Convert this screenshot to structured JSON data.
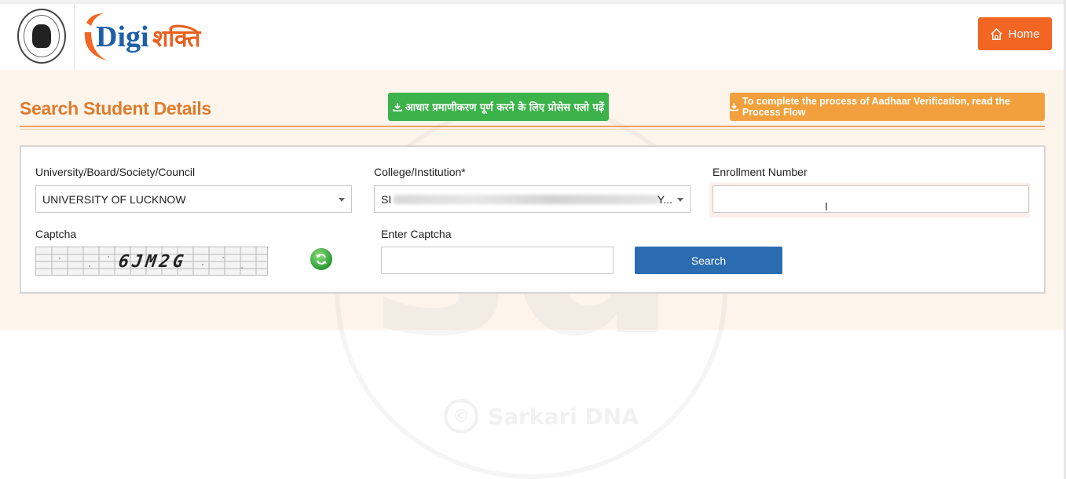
{
  "header": {
    "logo_text_latin": "Digi",
    "logo_text_devanagari": "शक्ति",
    "home_label": "Home"
  },
  "colors": {
    "primary_orange": "#f26522",
    "title_orange": "#e07b2c",
    "green_button": "#3bb34a",
    "orange_button": "#f2a03d",
    "search_blue": "#2b6cb0"
  },
  "section": {
    "title": "Search Student Details",
    "process_flow_hindi": "आधार प्रमाणीकरण पूर्ण करने के लिए प्रोसेस फ्लो पढ़ें",
    "process_flow_english": "To complete the process of Aadhaar Verification, read the Process Flow"
  },
  "form": {
    "university_label": "University/Board/Society/Council",
    "university_value": "UNIVERSITY OF LUCKNOW",
    "college_label": "College/Institution*",
    "college_value_prefix": "SI",
    "college_value_suffix": "Y...",
    "enrollment_label": "Enrollment Number",
    "enrollment_value": "",
    "captcha_label": "Captcha",
    "captcha_code": "6JM2G",
    "enter_captcha_label": "Enter Captcha",
    "enter_captcha_value": "",
    "search_label": "Search"
  },
  "watermark": {
    "letters": "sd",
    "copyright": "©",
    "text": "Sarkari DNA"
  },
  "icons": {
    "home": "home-icon",
    "download": "download-icon",
    "refresh": "refresh-icon",
    "dropdown": "chevron-down-icon",
    "text_cursor": "text-cursor-icon"
  }
}
